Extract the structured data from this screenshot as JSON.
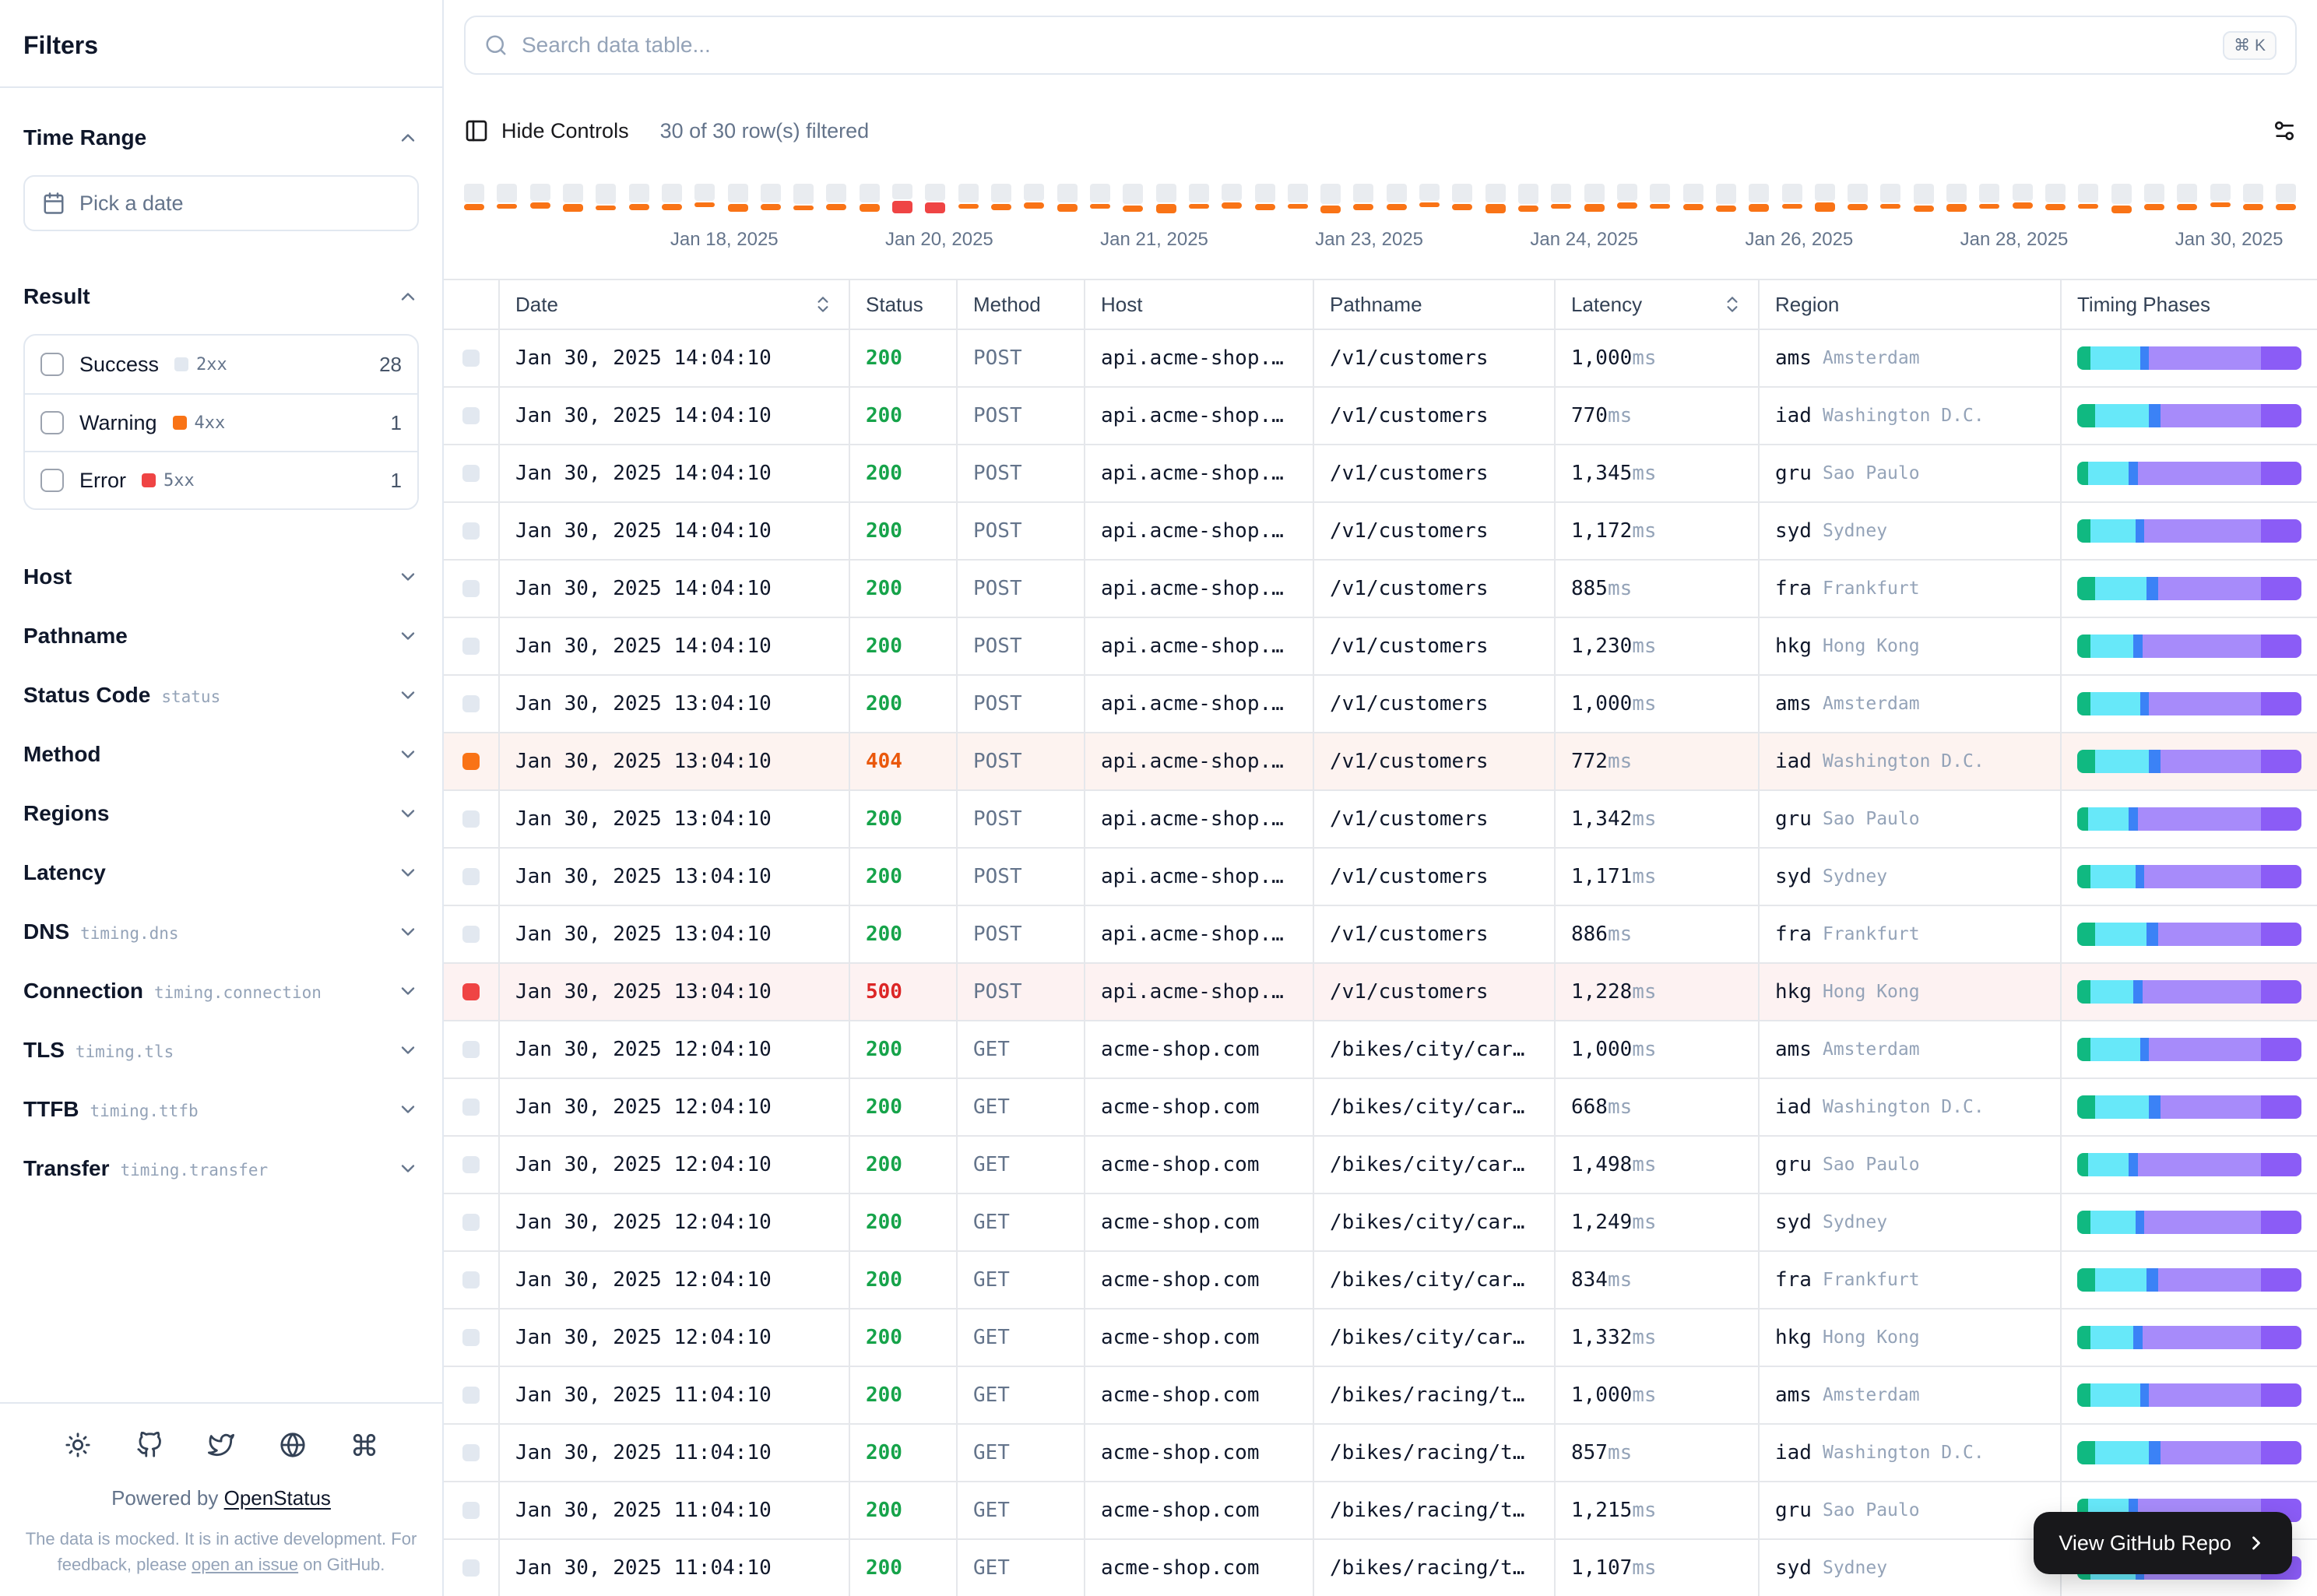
{
  "sidebar": {
    "title": "Filters",
    "time_range": {
      "label": "Time Range",
      "picker_placeholder": "Pick a date"
    },
    "result": {
      "label": "Result",
      "options": [
        {
          "label": "Success",
          "badge": "2xx",
          "count": "28",
          "color": "#e2e8f0"
        },
        {
          "label": "Warning",
          "badge": "4xx",
          "count": "1",
          "color": "#f97316"
        },
        {
          "label": "Error",
          "badge": "5xx",
          "count": "1",
          "color": "#ef4444"
        }
      ]
    },
    "sections": [
      {
        "label": "Host"
      },
      {
        "label": "Pathname"
      },
      {
        "label": "Status Code",
        "code": "status"
      },
      {
        "label": "Method"
      },
      {
        "label": "Regions"
      },
      {
        "label": "Latency"
      },
      {
        "label": "DNS",
        "code": "timing.dns"
      },
      {
        "label": "Connection",
        "code": "timing.connection"
      },
      {
        "label": "TLS",
        "code": "timing.tls"
      },
      {
        "label": "TTFB",
        "code": "timing.ttfb"
      },
      {
        "label": "Transfer",
        "code": "timing.transfer"
      }
    ],
    "footer": {
      "powered_by": "Powered by",
      "brand": "OpenStatus",
      "note_prefix": "The data is mocked. It is in active development. For feedback, please ",
      "note_link": "open an issue",
      "note_suffix": " on GitHub."
    }
  },
  "toolbar": {
    "search_placeholder": "Search data table...",
    "kbd": "⌘ K",
    "hide_controls": "Hide Controls",
    "filtered": "30 of 30 row(s) filtered"
  },
  "histogram": {
    "colors": {
      "base": "#e9ecf0",
      "warning": "#f97316",
      "error": "#ef4444"
    },
    "dates": [
      "Jan 18, 2025",
      "Jan 20, 2025",
      "Jan 21, 2025",
      "Jan 23, 2025",
      "Jan 24, 2025",
      "Jan 26, 2025",
      "Jan 28, 2025",
      "Jan 30, 2025"
    ],
    "bars": [
      [
        12,
        4,
        "o"
      ],
      [
        12,
        3,
        "o"
      ],
      [
        11,
        4,
        "o"
      ],
      [
        12,
        5,
        "o"
      ],
      [
        13,
        3,
        "o"
      ],
      [
        12,
        4,
        "o"
      ],
      [
        12,
        4,
        "o"
      ],
      [
        11,
        3,
        "o"
      ],
      [
        12,
        5,
        "o"
      ],
      [
        12,
        4,
        "o"
      ],
      [
        13,
        3,
        "o"
      ],
      [
        12,
        4,
        "o"
      ],
      [
        12,
        5,
        "o"
      ],
      [
        10,
        8,
        "r"
      ],
      [
        11,
        7,
        "r"
      ],
      [
        12,
        3,
        "o"
      ],
      [
        12,
        4,
        "o"
      ],
      [
        11,
        4,
        "o"
      ],
      [
        12,
        5,
        "o"
      ],
      [
        12,
        3,
        "o"
      ],
      [
        13,
        4,
        "o"
      ],
      [
        12,
        6,
        "o"
      ],
      [
        12,
        3,
        "o"
      ],
      [
        11,
        4,
        "o"
      ],
      [
        12,
        4,
        "o"
      ],
      [
        12,
        3,
        "o"
      ],
      [
        13,
        5,
        "o"
      ],
      [
        12,
        4,
        "o"
      ],
      [
        12,
        4,
        "o"
      ],
      [
        11,
        3,
        "o"
      ],
      [
        12,
        4,
        "o"
      ],
      [
        12,
        6,
        "o"
      ],
      [
        13,
        4,
        "o"
      ],
      [
        12,
        3,
        "o"
      ],
      [
        12,
        5,
        "o"
      ],
      [
        11,
        4,
        "o"
      ],
      [
        12,
        3,
        "o"
      ],
      [
        12,
        4,
        "o"
      ],
      [
        13,
        4,
        "o"
      ],
      [
        12,
        5,
        "o"
      ],
      [
        12,
        3,
        "o"
      ],
      [
        11,
        6,
        "o"
      ],
      [
        12,
        4,
        "o"
      ],
      [
        12,
        3,
        "o"
      ],
      [
        13,
        4,
        "o"
      ],
      [
        12,
        5,
        "o"
      ],
      [
        12,
        3,
        "o"
      ],
      [
        11,
        4,
        "o"
      ],
      [
        12,
        4,
        "o"
      ],
      [
        12,
        3,
        "o"
      ],
      [
        13,
        5,
        "o"
      ],
      [
        12,
        4,
        "o"
      ],
      [
        12,
        4,
        "o"
      ],
      [
        11,
        3,
        "o"
      ],
      [
        12,
        4,
        "o"
      ],
      [
        12,
        4,
        "o"
      ]
    ]
  },
  "table": {
    "columns": [
      {
        "label": "Date",
        "sortable": true
      },
      {
        "label": "Status"
      },
      {
        "label": "Method"
      },
      {
        "label": "Host"
      },
      {
        "label": "Pathname"
      },
      {
        "label": "Latency",
        "sortable": true
      },
      {
        "label": "Region"
      },
      {
        "label": "Timing Phases"
      }
    ],
    "latency_unit": "ms",
    "status_colors": {
      "success": "#16a34a",
      "warning": "#ea580c",
      "error": "#dc2626"
    },
    "indicator_colors": {
      "success": "#e2e8f0",
      "warning": "#f97316",
      "error": "#ef4444"
    },
    "timing_phases": [
      "dns",
      "connection",
      "tls",
      "ttfb",
      "transfer"
    ],
    "timing_colors": [
      "#10b981",
      "#67e8f9",
      "#3b82f6",
      "#a78bfa",
      "#8b5cf6"
    ],
    "rows": [
      {
        "date": "Jan 30, 2025 14:04:10",
        "status": "200",
        "level": "success",
        "method": "POST",
        "host": "api.acme-shop.…",
        "pathname": "/v1/customers",
        "latency": "1,000",
        "region": "ams",
        "city": "Amsterdam",
        "timing": [
          6,
          22,
          4,
          50,
          18
        ]
      },
      {
        "date": "Jan 30, 2025 14:04:10",
        "status": "200",
        "level": "success",
        "method": "POST",
        "host": "api.acme-shop.…",
        "pathname": "/v1/customers",
        "latency": "770",
        "region": "iad",
        "city": "Washington D.C.",
        "timing": [
          8,
          24,
          5,
          45,
          18
        ]
      },
      {
        "date": "Jan 30, 2025 14:04:10",
        "status": "200",
        "level": "success",
        "method": "POST",
        "host": "api.acme-shop.…",
        "pathname": "/v1/customers",
        "latency": "1,345",
        "region": "gru",
        "city": "Sao Paulo",
        "timing": [
          5,
          18,
          4,
          55,
          18
        ]
      },
      {
        "date": "Jan 30, 2025 14:04:10",
        "status": "200",
        "level": "success",
        "method": "POST",
        "host": "api.acme-shop.…",
        "pathname": "/v1/customers",
        "latency": "1,172",
        "region": "syd",
        "city": "Sydney",
        "timing": [
          6,
          20,
          4,
          52,
          18
        ]
      },
      {
        "date": "Jan 30, 2025 14:04:10",
        "status": "200",
        "level": "success",
        "method": "POST",
        "host": "api.acme-shop.…",
        "pathname": "/v1/customers",
        "latency": "885",
        "region": "fra",
        "city": "Frankfurt",
        "timing": [
          8,
          23,
          5,
          46,
          18
        ]
      },
      {
        "date": "Jan 30, 2025 14:04:10",
        "status": "200",
        "level": "success",
        "method": "POST",
        "host": "api.acme-shop.…",
        "pathname": "/v1/customers",
        "latency": "1,230",
        "region": "hkg",
        "city": "Hong Kong",
        "timing": [
          6,
          19,
          4,
          53,
          18
        ]
      },
      {
        "date": "Jan 30, 2025 13:04:10",
        "status": "200",
        "level": "success",
        "method": "POST",
        "host": "api.acme-shop.…",
        "pathname": "/v1/customers",
        "latency": "1,000",
        "region": "ams",
        "city": "Amsterdam",
        "timing": [
          6,
          22,
          4,
          50,
          18
        ]
      },
      {
        "date": "Jan 30, 2025 13:04:10",
        "status": "404",
        "level": "warning",
        "method": "POST",
        "host": "api.acme-shop.…",
        "pathname": "/v1/customers",
        "latency": "772",
        "region": "iad",
        "city": "Washington D.C.",
        "timing": [
          8,
          24,
          5,
          45,
          18
        ]
      },
      {
        "date": "Jan 30, 2025 13:04:10",
        "status": "200",
        "level": "success",
        "method": "POST",
        "host": "api.acme-shop.…",
        "pathname": "/v1/customers",
        "latency": "1,342",
        "region": "gru",
        "city": "Sao Paulo",
        "timing": [
          5,
          18,
          4,
          55,
          18
        ]
      },
      {
        "date": "Jan 30, 2025 13:04:10",
        "status": "200",
        "level": "success",
        "method": "POST",
        "host": "api.acme-shop.…",
        "pathname": "/v1/customers",
        "latency": "1,171",
        "region": "syd",
        "city": "Sydney",
        "timing": [
          6,
          20,
          4,
          52,
          18
        ]
      },
      {
        "date": "Jan 30, 2025 13:04:10",
        "status": "200",
        "level": "success",
        "method": "POST",
        "host": "api.acme-shop.…",
        "pathname": "/v1/customers",
        "latency": "886",
        "region": "fra",
        "city": "Frankfurt",
        "timing": [
          8,
          23,
          5,
          46,
          18
        ]
      },
      {
        "date": "Jan 30, 2025 13:04:10",
        "status": "500",
        "level": "error",
        "method": "POST",
        "host": "api.acme-shop.…",
        "pathname": "/v1/customers",
        "latency": "1,228",
        "region": "hkg",
        "city": "Hong Kong",
        "timing": [
          6,
          19,
          4,
          53,
          18
        ]
      },
      {
        "date": "Jan 30, 2025 12:04:10",
        "status": "200",
        "level": "success",
        "method": "GET",
        "host": "acme-shop.com",
        "pathname": "/bikes/city/car…",
        "latency": "1,000",
        "region": "ams",
        "city": "Amsterdam",
        "timing": [
          6,
          22,
          4,
          50,
          18
        ]
      },
      {
        "date": "Jan 30, 2025 12:04:10",
        "status": "200",
        "level": "success",
        "method": "GET",
        "host": "acme-shop.com",
        "pathname": "/bikes/city/car…",
        "latency": "668",
        "region": "iad",
        "city": "Washington D.C.",
        "timing": [
          8,
          24,
          5,
          45,
          18
        ]
      },
      {
        "date": "Jan 30, 2025 12:04:10",
        "status": "200",
        "level": "success",
        "method": "GET",
        "host": "acme-shop.com",
        "pathname": "/bikes/city/car…",
        "latency": "1,498",
        "region": "gru",
        "city": "Sao Paulo",
        "timing": [
          5,
          18,
          4,
          55,
          18
        ]
      },
      {
        "date": "Jan 30, 2025 12:04:10",
        "status": "200",
        "level": "success",
        "method": "GET",
        "host": "acme-shop.com",
        "pathname": "/bikes/city/car…",
        "latency": "1,249",
        "region": "syd",
        "city": "Sydney",
        "timing": [
          6,
          20,
          4,
          52,
          18
        ]
      },
      {
        "date": "Jan 30, 2025 12:04:10",
        "status": "200",
        "level": "success",
        "method": "GET",
        "host": "acme-shop.com",
        "pathname": "/bikes/city/car…",
        "latency": "834",
        "region": "fra",
        "city": "Frankfurt",
        "timing": [
          8,
          23,
          5,
          46,
          18
        ]
      },
      {
        "date": "Jan 30, 2025 12:04:10",
        "status": "200",
        "level": "success",
        "method": "GET",
        "host": "acme-shop.com",
        "pathname": "/bikes/city/car…",
        "latency": "1,332",
        "region": "hkg",
        "city": "Hong Kong",
        "timing": [
          6,
          19,
          4,
          53,
          18
        ]
      },
      {
        "date": "Jan 30, 2025 11:04:10",
        "status": "200",
        "level": "success",
        "method": "GET",
        "host": "acme-shop.com",
        "pathname": "/bikes/racing/t…",
        "latency": "1,000",
        "region": "ams",
        "city": "Amsterdam",
        "timing": [
          6,
          22,
          4,
          50,
          18
        ]
      },
      {
        "date": "Jan 30, 2025 11:04:10",
        "status": "200",
        "level": "success",
        "method": "GET",
        "host": "acme-shop.com",
        "pathname": "/bikes/racing/t…",
        "latency": "857",
        "region": "iad",
        "city": "Washington D.C.",
        "timing": [
          8,
          24,
          5,
          45,
          18
        ]
      },
      {
        "date": "Jan 30, 2025 11:04:10",
        "status": "200",
        "level": "success",
        "method": "GET",
        "host": "acme-shop.com",
        "pathname": "/bikes/racing/t…",
        "latency": "1,215",
        "region": "gru",
        "city": "Sao Paulo",
        "timing": [
          5,
          18,
          4,
          55,
          18
        ]
      },
      {
        "date": "Jan 30, 2025 11:04:10",
        "status": "200",
        "level": "success",
        "method": "GET",
        "host": "acme-shop.com",
        "pathname": "/bikes/racing/t…",
        "latency": "1,107",
        "region": "syd",
        "city": "Sydney",
        "timing": [
          6,
          20,
          4,
          52,
          18
        ]
      }
    ]
  },
  "github_button": {
    "label": "View GitHub Repo"
  }
}
